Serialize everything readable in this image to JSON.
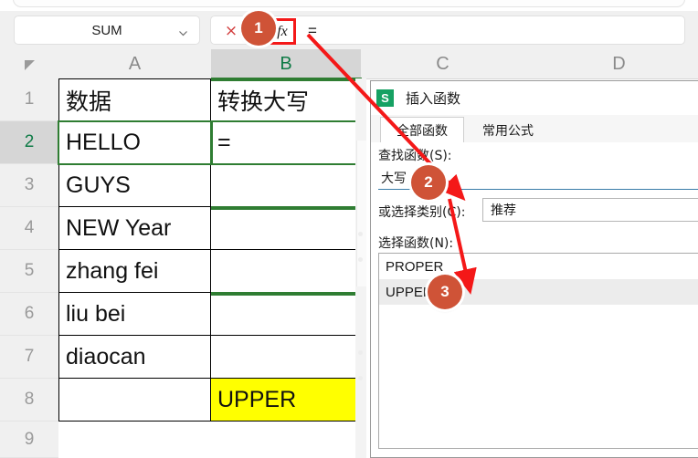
{
  "formula_bar": {
    "name_box_value": "SUM",
    "name_box_chevron_icon": "chevron-down-icon",
    "cancel_icon": "×",
    "fx_icon_label": "fx",
    "formula_value": "="
  },
  "sheet": {
    "select_all_icon": "select-all-triangle-icon",
    "columns": [
      {
        "label": "A",
        "active": false
      },
      {
        "label": "B",
        "active": true
      },
      {
        "label": "C",
        "active": false
      },
      {
        "label": "D",
        "active": false
      }
    ],
    "rows": [
      {
        "num": "1",
        "active": false,
        "a": "数据",
        "b": "转换大写"
      },
      {
        "num": "2",
        "active": true,
        "a": "HELLO",
        "b": "="
      },
      {
        "num": "3",
        "active": false,
        "a": "GUYS",
        "b": ""
      },
      {
        "num": "4",
        "active": false,
        "a": "NEW Year",
        "b": ""
      },
      {
        "num": "5",
        "active": false,
        "a": "zhang fei",
        "b": ""
      },
      {
        "num": "6",
        "active": false,
        "a": "liu bei",
        "b": ""
      },
      {
        "num": "7",
        "active": false,
        "a": "diaocan",
        "b": ""
      },
      {
        "num": "8",
        "active": false,
        "a": "",
        "b": "UPPER"
      },
      {
        "num": "9",
        "active": false,
        "a": "",
        "b": ""
      }
    ],
    "highlight_cell_color": "#ffff00",
    "selection_color": "#2f7d32"
  },
  "dialog": {
    "logo_letter": "S",
    "title": "插入函数",
    "tabs": [
      {
        "label": "全部函数",
        "active": true
      },
      {
        "label": "常用公式",
        "active": false
      }
    ],
    "search_label": "查找函数(S):",
    "search_value": "大写",
    "category_label": "或选择类别(C):",
    "category_value": "推荐",
    "function_list_label": "选择函数(N):",
    "functions": [
      {
        "name": "PROPER",
        "selected": false
      },
      {
        "name": "UPPER",
        "selected": true
      }
    ]
  },
  "annotations": {
    "accent_color": "#cf5337",
    "arrow_color": "#f41818",
    "badges": [
      {
        "label": "1"
      },
      {
        "label": "2"
      },
      {
        "label": "3"
      }
    ]
  }
}
